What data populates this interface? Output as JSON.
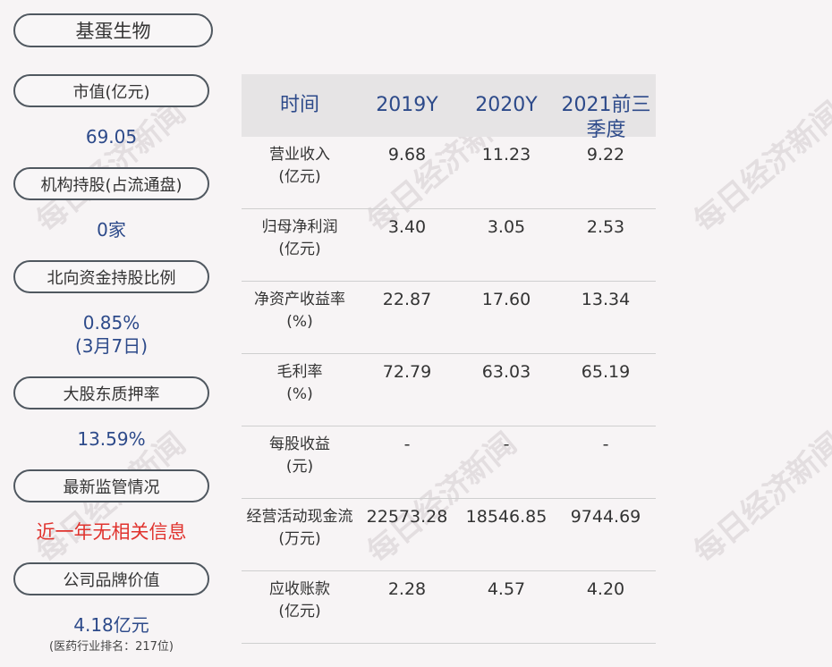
{
  "title": "基蛋生物",
  "left_panel": {
    "market_value_label": "市值(亿元)",
    "market_value": "69.05",
    "institution_label": "机构持股(占流通盘)",
    "institution_value": "0家",
    "northbound_label": "北向资金持股比例",
    "northbound_value": "0.85%",
    "northbound_date": "(3月7日)",
    "pledge_label": "大股东质押率",
    "pledge_value": "13.59%",
    "regulation_label": "最新监管情况",
    "regulation_value": "近一年无相关信息",
    "brand_label": "公司品牌价值",
    "brand_value": "4.18亿元",
    "brand_rank": "(医药行业排名：217位)"
  },
  "table": {
    "headers": [
      "时间",
      "2019Y",
      "2020Y",
      "2021前三季度"
    ],
    "rows": [
      {
        "label": "营业收入",
        "unit": "(亿元)",
        "values": [
          "9.68",
          "11.23",
          "9.22"
        ]
      },
      {
        "label": "归母净利润",
        "unit": "(亿元)",
        "values": [
          "3.40",
          "3.05",
          "2.53"
        ]
      },
      {
        "label": "净资产收益率",
        "unit": "(%)",
        "values": [
          "22.87",
          "17.60",
          "13.34"
        ]
      },
      {
        "label": "毛利率",
        "unit": "(%)",
        "values": [
          "72.79",
          "63.03",
          "65.19"
        ]
      },
      {
        "label": "每股收益",
        "unit": "(元)",
        "values": [
          "-",
          "-",
          "-"
        ]
      },
      {
        "label": "经营活动现金流",
        "unit": "(万元)",
        "values": [
          "22573.28",
          "18546.85",
          "9744.69"
        ]
      },
      {
        "label": "应收账款",
        "unit": "(亿元)",
        "values": [
          "2.28",
          "4.57",
          "4.20"
        ]
      }
    ]
  },
  "watermark": "每日经济新闻"
}
